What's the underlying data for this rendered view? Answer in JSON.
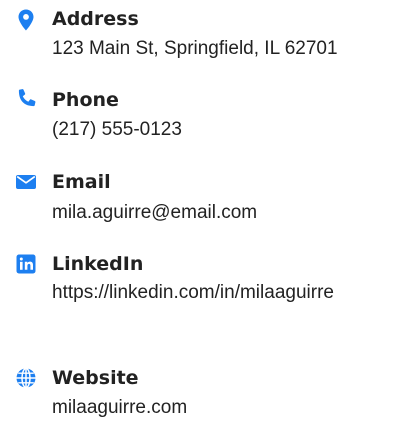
{
  "theme": {
    "accent": "#1d7ff0",
    "text": "#222222"
  },
  "contacts": [
    {
      "icon": "map-pin-icon",
      "label": "Address",
      "value": "123 Main St, Springfield, IL 62701"
    },
    {
      "icon": "phone-icon",
      "label": "Phone",
      "value": "(217) 555-0123"
    },
    {
      "icon": "envelope-icon",
      "label": "Email",
      "value": "mila.aguirre@email.com"
    },
    {
      "icon": "linkedin-icon",
      "label": "LinkedIn",
      "value": "https://linkedin.com/in/milaaguirre"
    },
    {
      "icon": "globe-icon",
      "label": "Website",
      "value": "milaaguirre.com"
    }
  ]
}
